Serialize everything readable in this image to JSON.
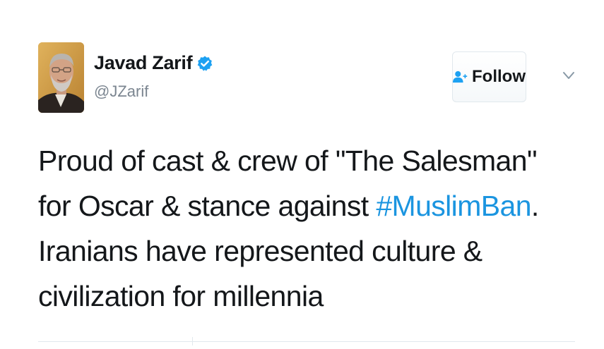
{
  "tweet": {
    "author": {
      "display_name": "Javad Zarif",
      "handle": "@JZarif",
      "avatar_icon": "profile-photo",
      "verified_icon": "verified-badge-icon",
      "verified_color": "#1da1f2"
    },
    "follow_button": {
      "label": "Follow",
      "icon": "add-user-icon",
      "icon_color": "#1da1f2"
    },
    "menu_icon": "chevron-down-icon",
    "text_before_hashtag": "Proud of cast & crew of \"The Salesman\" for Oscar & stance against ",
    "hashtag": "#MuslimBan",
    "text_after_hashtag": ". Iranians have represented culture & civilization for millennia",
    "hashtag_color": "#1b95e0"
  }
}
